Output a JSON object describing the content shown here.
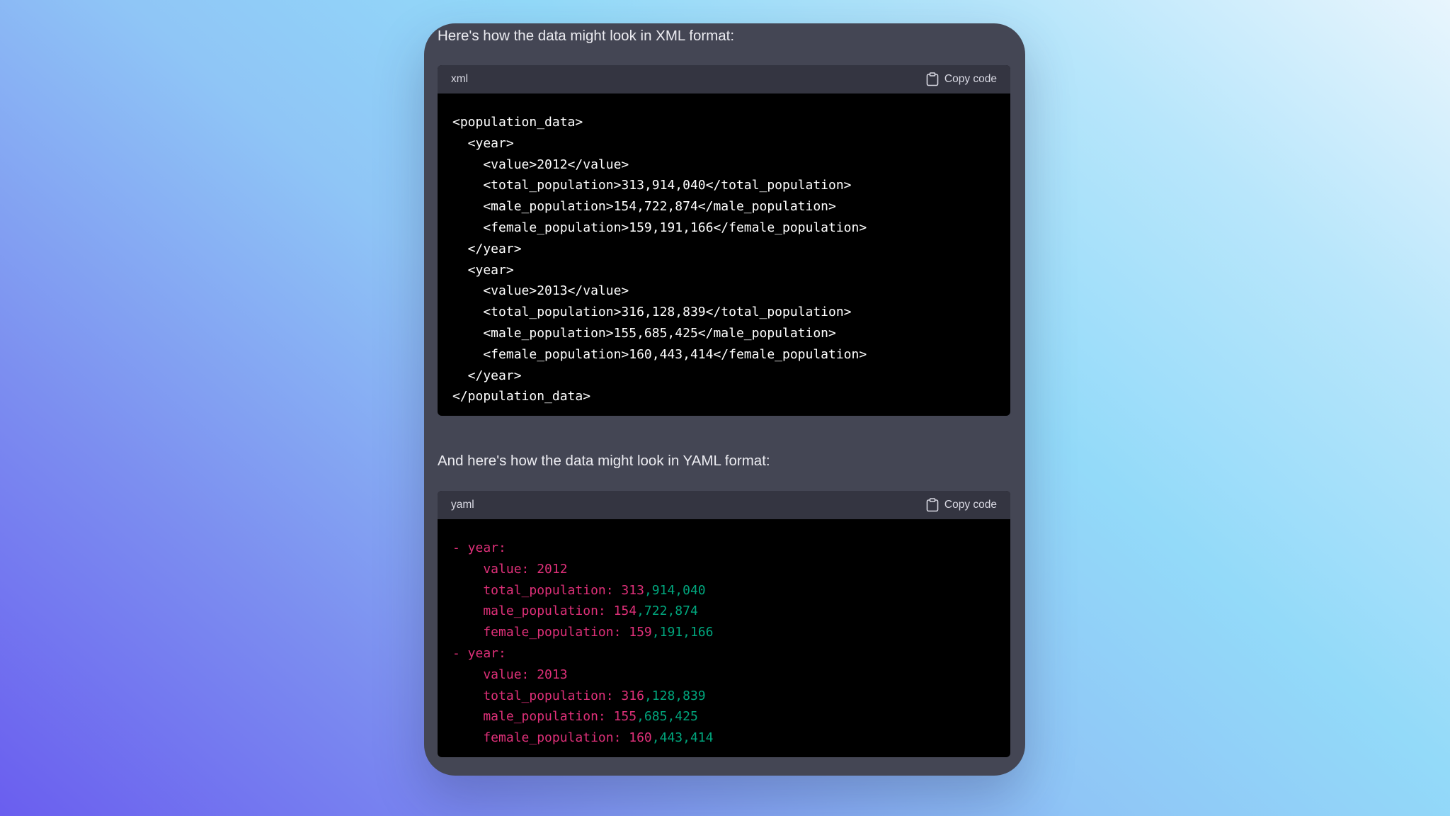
{
  "intro_xml": "Here's how the data might look in XML format:",
  "intro_yaml": "And here's how the data might look in YAML format:",
  "xml_block": {
    "language": "xml",
    "copy_label": "Copy code",
    "lines": [
      "<population_data>",
      "  <year>",
      "    <value>2012</value>",
      "    <total_population>313,914,040</total_population>",
      "    <male_population>154,722,874</male_population>",
      "    <female_population>159,191,166</female_population>",
      "  </year>",
      "  <year>",
      "    <value>2013</value>",
      "    <total_population>316,128,839</total_population>",
      "    <male_population>155,685,425</male_population>",
      "    <female_population>160,443,414</female_population>",
      "  </year>",
      "</population_data>"
    ]
  },
  "yaml_block": {
    "language": "yaml",
    "copy_label": "Copy code",
    "lines": [
      {
        "key": "- year:",
        "num_head": "",
        "num_rest": ""
      },
      {
        "key": "    value: ",
        "num_head": "2012",
        "num_rest": ""
      },
      {
        "key": "    total_population: ",
        "num_head": "313",
        "num_rest": ",914,040"
      },
      {
        "key": "    male_population: ",
        "num_head": "154",
        "num_rest": ",722,874"
      },
      {
        "key": "    female_population: ",
        "num_head": "159",
        "num_rest": ",191,166"
      },
      {
        "key": "- year:",
        "num_head": "",
        "num_rest": ""
      },
      {
        "key": "    value: ",
        "num_head": "2013",
        "num_rest": ""
      },
      {
        "key": "    total_population: ",
        "num_head": "316",
        "num_rest": ",128,839"
      },
      {
        "key": "    male_population: ",
        "num_head": "155",
        "num_rest": ",685,425"
      },
      {
        "key": "    female_population: ",
        "num_head": "160",
        "num_rest": ",443,414"
      }
    ]
  },
  "colors": {
    "card_bg": "#444654",
    "code_header_bg": "#343541",
    "code_bg": "#000000",
    "yaml_key": "#df3079",
    "yaml_number_rest": "#00a67d"
  },
  "icons": {
    "copy": "clipboard-icon"
  }
}
